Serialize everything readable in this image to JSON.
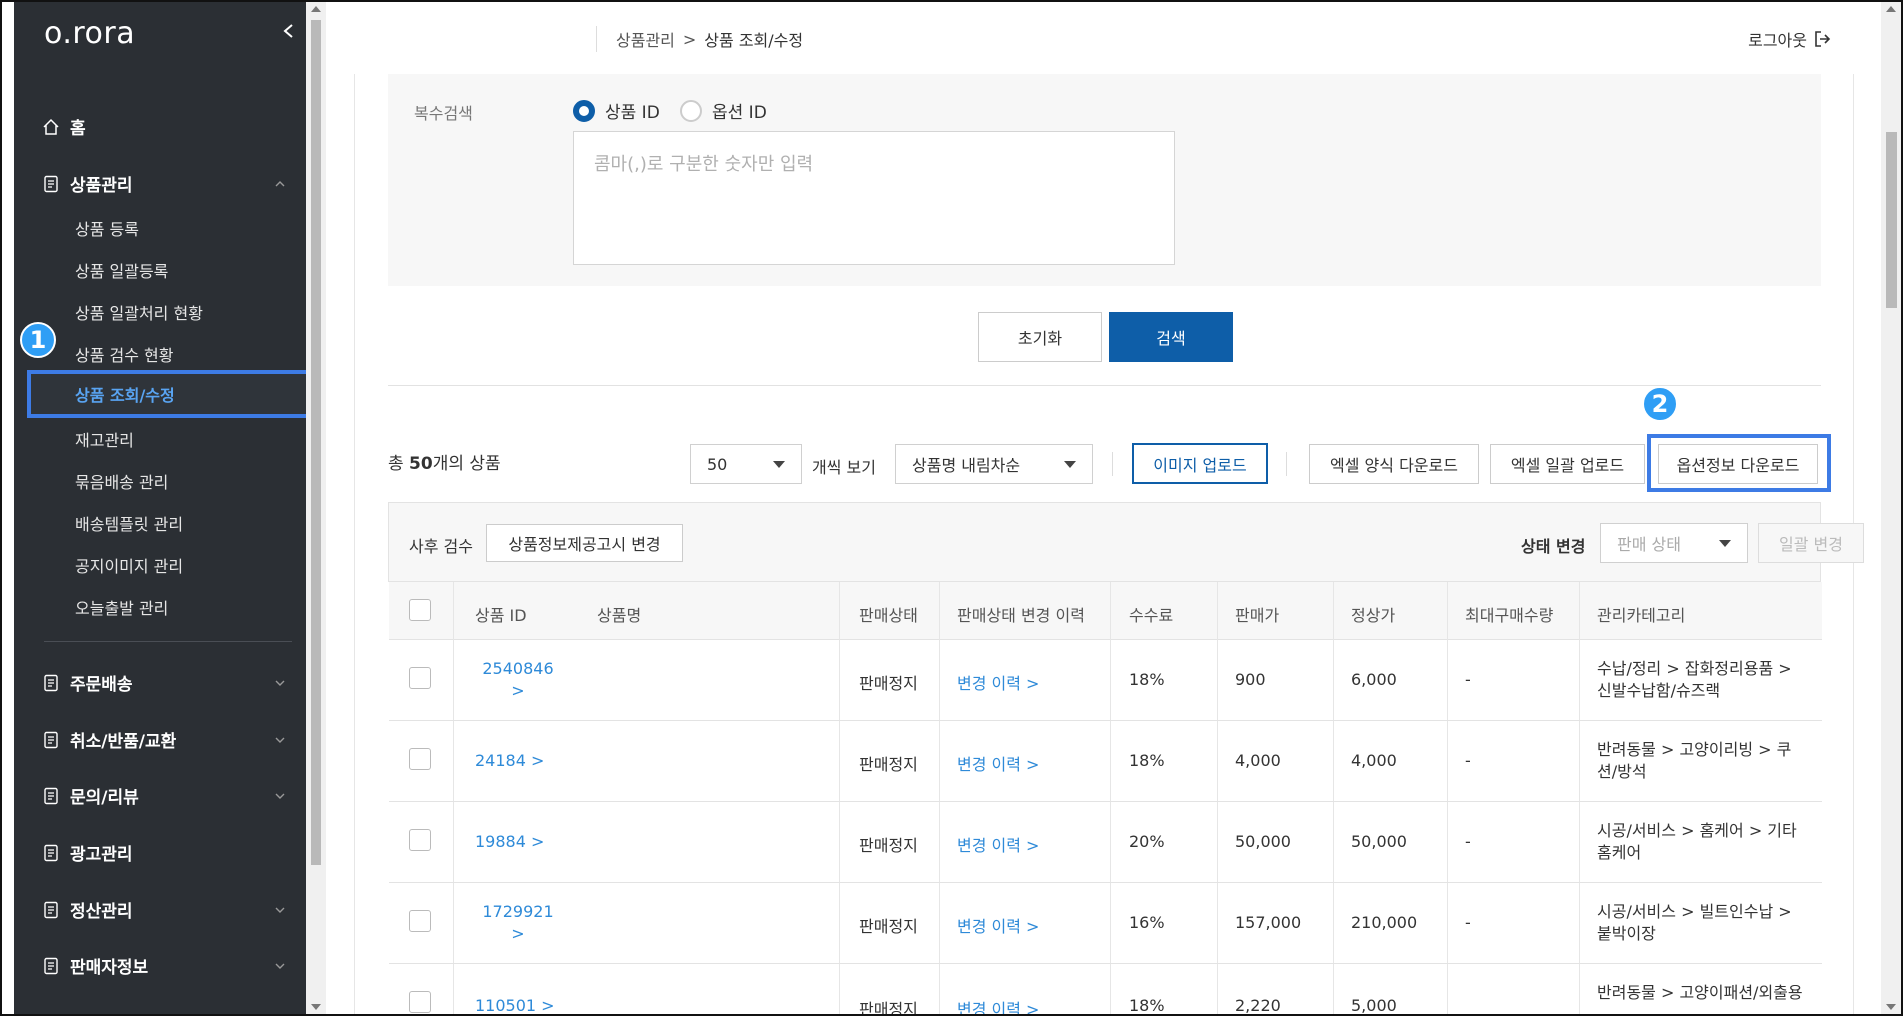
{
  "app": {
    "logo": "o.rora"
  },
  "sidebar": {
    "home": "홈",
    "product_mgmt": "상품관리",
    "sub_items": [
      "상품 등록",
      "상품 일괄등록",
      "상품 일괄처리 현황",
      "상품 검수 현황",
      "상품 조회/수정",
      "재고관리",
      "묶음배송 관리",
      "배송템플릿 관리",
      "공지이미지 관리",
      "오늘출발 관리"
    ],
    "sections": [
      "주문배송",
      "취소/반품/교환",
      "문의/리뷰",
      "광고관리",
      "정산관리",
      "판매자정보"
    ]
  },
  "annotations": {
    "badge1": "1",
    "badge2": "2"
  },
  "header": {
    "breadcrumb_parent": "상품관리",
    "breadcrumb_sep": ">",
    "breadcrumb_current": "상품 조회/수정",
    "logout": "로그아웃"
  },
  "search": {
    "multi_label": "복수검색",
    "radio_product_id": "상품 ID",
    "radio_option_id": "옵션 ID",
    "selected": "상품 ID",
    "textarea_placeholder": "콤마(,)로 구분한 숫자만 입력",
    "reset": "초기화",
    "search": "검색"
  },
  "list": {
    "total_prefix": "총 ",
    "total_count": "50",
    "total_suffix": "개의 상품",
    "page_size": "50",
    "view_label": "개씩 보기",
    "sort": "상품명 내림차순",
    "image_upload": "이미지 업로드",
    "excel_form_download": "엑셀 양식 다운로드",
    "excel_bulk_upload": "엑셀 일괄 업로드",
    "option_download": "옵션정보 다운로드"
  },
  "toolbar": {
    "post_review": "사후 검수",
    "notice_change": "상품정보제공고시 변경",
    "status_change": "상태 변경",
    "status_placeholder": "판매 상태",
    "bulk_change": "일괄 변경"
  },
  "table": {
    "headers": [
      "상품 ID",
      "상품명",
      "판매상태",
      "판매상태 변경 이력",
      "수수료",
      "판매가",
      "정상가",
      "최대구매수량",
      "관리카테고리"
    ],
    "rows": [
      {
        "id": "2540846",
        "id_arrow": ">",
        "status": "판매정지",
        "history": "변경 이력 >",
        "fee": "18%",
        "price": "900",
        "list_price": "6,000",
        "max_qty": "-",
        "category": "수납/정리 > 잡화정리용품 > 신발수납함/슈즈랙"
      },
      {
        "id": "24184 >",
        "id_arrow": "",
        "status": "판매정지",
        "history": "변경 이력 >",
        "fee": "18%",
        "price": "4,000",
        "list_price": "4,000",
        "max_qty": "-",
        "category": "반려동물 > 고양이리빙 > 쿠션/방석"
      },
      {
        "id": "19884 >",
        "id_arrow": "",
        "status": "판매정지",
        "history": "변경 이력 >",
        "fee": "20%",
        "price": "50,000",
        "list_price": "50,000",
        "max_qty": "-",
        "category": "시공/서비스 > 홈케어 > 기타홈케어"
      },
      {
        "id": "1729921",
        "id_arrow": ">",
        "status": "판매정지",
        "history": "변경 이력 >",
        "fee": "16%",
        "price": "157,000",
        "list_price": "210,000",
        "max_qty": "-",
        "category": "시공/서비스 > 빌트인수납 > 붙박이장"
      },
      {
        "id": "110501 >",
        "id_arrow": "",
        "status": "판매정지",
        "history": "변경 이력 >",
        "fee": "18%",
        "price": "2,220",
        "list_price": "5,000",
        "max_qty": "",
        "category": "반려동물 > 고양이패션/외출용"
      }
    ]
  }
}
